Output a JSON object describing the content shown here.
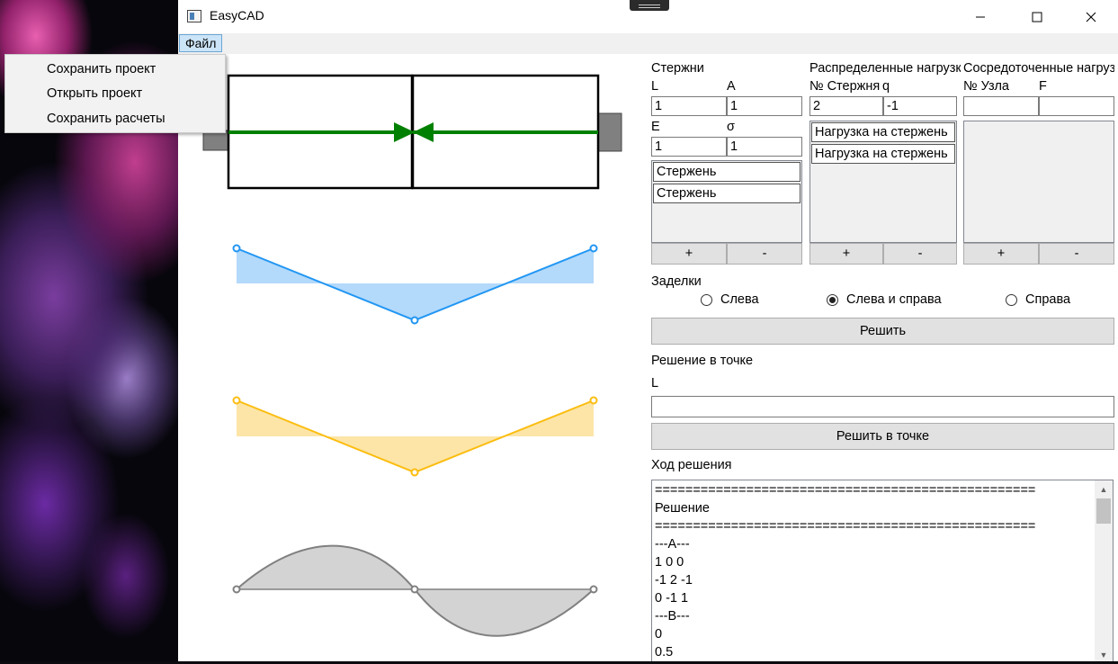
{
  "window": {
    "title": "EasyCAD"
  },
  "menu": {
    "file": "Файл",
    "items": [
      "Сохранить проект",
      "Открыть проект",
      "Сохранить расчеты"
    ]
  },
  "rods": {
    "title": "Стержни",
    "l_label": "L",
    "a_label": "A",
    "e_label": "E",
    "s_label": "σ",
    "l_value": "1",
    "a_value": "1",
    "e_value": "1",
    "s_value": "1",
    "items": [
      "Стержень",
      "Стержень"
    ],
    "add": "+",
    "remove": "-"
  },
  "dist_loads": {
    "title": "Распределенные нагрузки",
    "rod_no_label": "№ Стержня",
    "q_label": "q",
    "rod_no_value": "2",
    "q_value": "-1",
    "items": [
      "Нагрузка на стержень",
      "Нагрузка на стержень"
    ],
    "add": "+",
    "remove": "-"
  },
  "conc_loads": {
    "title": "Сосредоточенные нагрузки",
    "node_no_label": "№ Узла",
    "f_label": "F",
    "node_no_value": "",
    "f_value": "",
    "add": "+",
    "remove": "-"
  },
  "supports": {
    "title": "Заделки",
    "options": [
      "Слева",
      "Слева и справа",
      "Справа"
    ],
    "selected": "Слева и справа"
  },
  "solve_button": "Решить",
  "point_solution": {
    "title": "Решение в точке",
    "l_label": "L",
    "l_value": "",
    "button": "Решить в точке"
  },
  "log": {
    "title": "Ход решения",
    "lines": [
      "==================================================",
      "Решение",
      "==================================================",
      "---A---",
      "1 0 0",
      "-1 2 -1",
      "0 -1 1",
      "---B---",
      "0",
      "0.5"
    ]
  },
  "colors": {
    "rod_force": "#008000",
    "diagram_n": "#2196f3",
    "diagram_n_fill": "#b3d9fb",
    "diagram_u": "#fbbd10",
    "diagram_u_fill": "#fde5a8",
    "diagram_s": "#808080",
    "diagram_s_fill": "#d3d3d3",
    "support": "#808080"
  }
}
